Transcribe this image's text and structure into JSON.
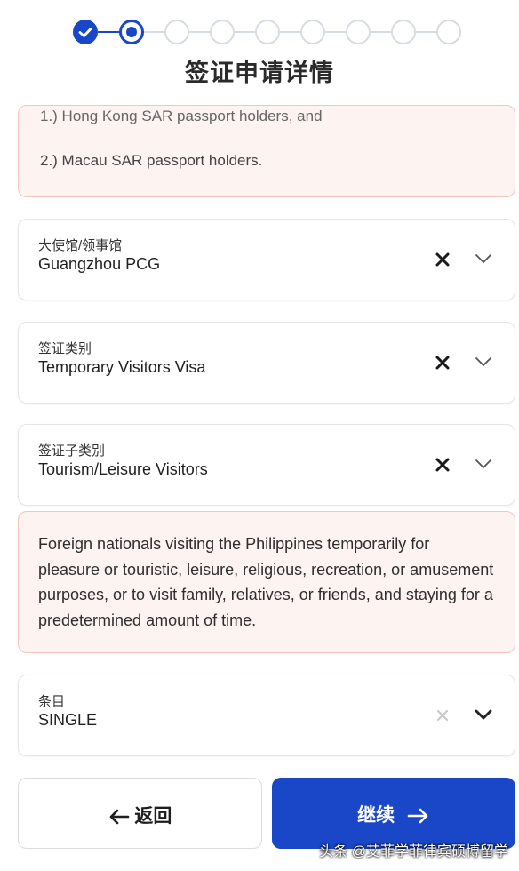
{
  "stepper": {
    "total_steps": 9,
    "completed_steps": 1,
    "current_step": 2
  },
  "title": "签证申请详情",
  "notice_top": {
    "line1": "1.)  Hong Kong SAR passport holders, and",
    "line2": "2.)  Macau SAR passport holders."
  },
  "fields": {
    "embassy": {
      "label": "大使馆/领事馆",
      "value": "Guangzhou PCG"
    },
    "visa_type": {
      "label": "签证类别",
      "value": "Temporary Visitors Visa"
    },
    "visa_subtype": {
      "label": "签证子类别",
      "value": "Tourism/Leisure Visitors"
    },
    "entry": {
      "label": "条目",
      "value": "SINGLE"
    }
  },
  "notice_body": "Foreign nationals visiting the Philippines temporarily for pleasure or touristic, leisure, religious, recreation, or amusement purposes, or to visit family, relatives, or friends, and staying for a predetermined amount of time.",
  "buttons": {
    "back_label": "返回",
    "next_label": "继续"
  },
  "watermark": "头条 @艾菲学菲律宾硕博留学",
  "colors": {
    "primary": "#1947c7",
    "notice_bg": "#fdf3f1",
    "notice_border": "#f3c5bd"
  },
  "icons": [
    "check-icon",
    "clear-icon",
    "chevron-down-icon",
    "arrow-left-icon",
    "arrow-right-icon"
  ]
}
